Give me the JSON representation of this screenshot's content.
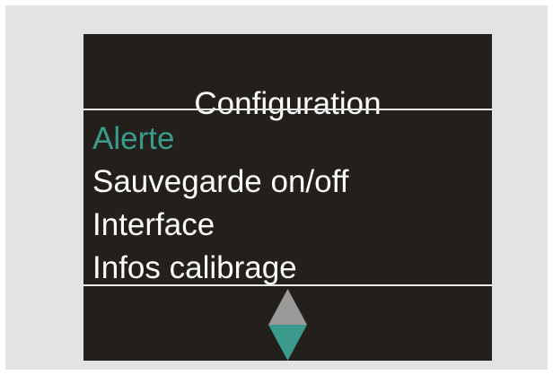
{
  "screen": {
    "title": "Configuration",
    "menu": {
      "items": [
        {
          "label": "Alerte",
          "selected": true
        },
        {
          "label": "Sauvegarde on/off",
          "selected": false
        },
        {
          "label": "Interface",
          "selected": false
        },
        {
          "label": "Infos calibrage",
          "selected": false
        }
      ]
    },
    "scroll_indicator": {
      "up_icon": "triangle-up-icon",
      "down_icon": "triangle-down-icon"
    }
  },
  "colors": {
    "screen_background": "#231f1b",
    "text": "#ffffff",
    "selected_text": "#3a9b8d",
    "up_arrow": "#9a9a9a",
    "down_arrow": "#3a9b8d",
    "frame_background": "#e3e3e3"
  }
}
